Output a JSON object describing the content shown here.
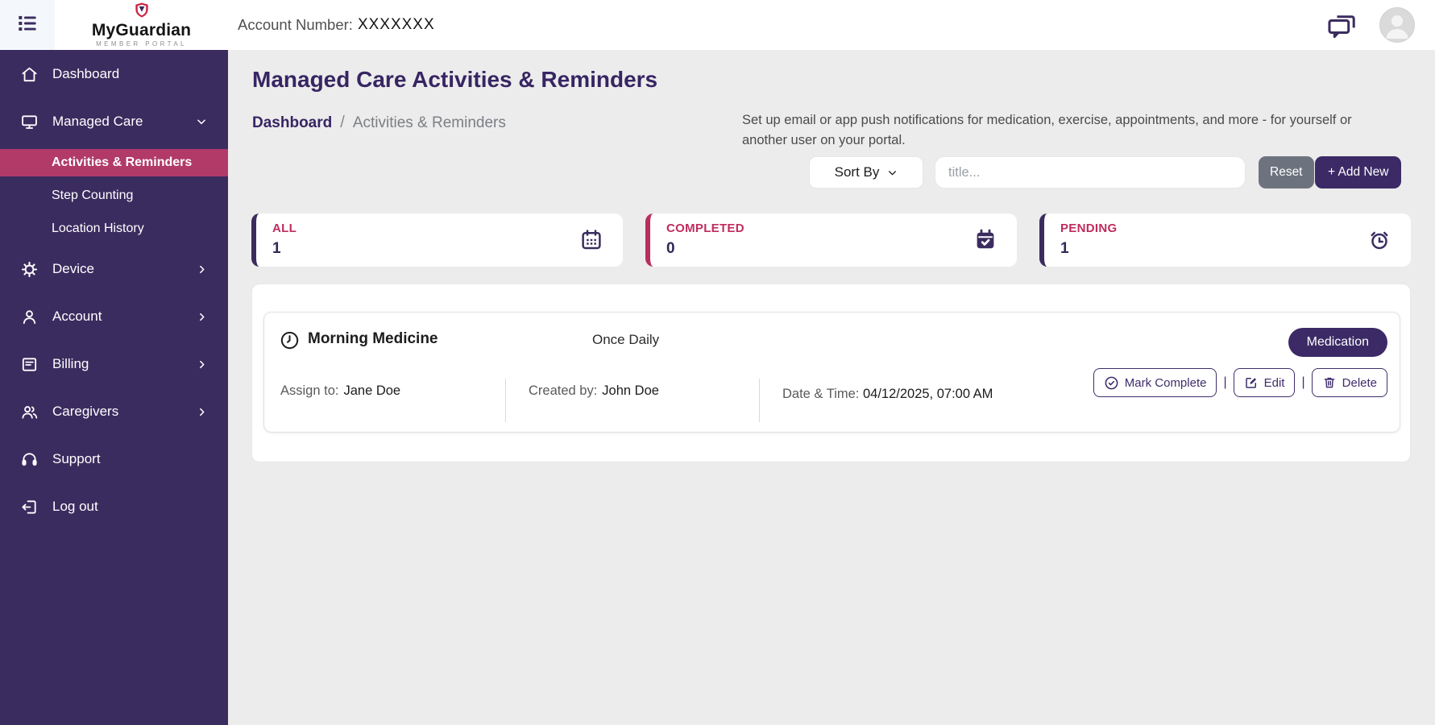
{
  "header": {
    "brand_name": "MyGuardian",
    "brand_tagline": "MEMBER PORTAL",
    "account_label": "Account Number:",
    "account_value": "XXXXXXX"
  },
  "sidebar": {
    "items": [
      {
        "label": "Dashboard"
      },
      {
        "label": "Managed Care"
      },
      {
        "label": "Activities & Reminders"
      },
      {
        "label": "Step Counting"
      },
      {
        "label": "Location History"
      },
      {
        "label": "Device"
      },
      {
        "label": "Account"
      },
      {
        "label": "Billing"
      },
      {
        "label": "Caregivers"
      },
      {
        "label": "Support"
      },
      {
        "label": "Log out"
      }
    ]
  },
  "page": {
    "title": "Managed Care Activities & Reminders",
    "breadcrumb_parent": "Dashboard",
    "breadcrumb_separator": "/",
    "breadcrumb_current": "Activities & Reminders",
    "description": "Set up email or app push notifications for medication, exercise, appointments, and more - for yourself or another user on your portal."
  },
  "toolbar": {
    "sort_label": "Sort By",
    "search_placeholder": "title...",
    "reset_label": "Reset",
    "add_new_label": "+ Add New"
  },
  "stats": [
    {
      "label": "ALL",
      "value": "1",
      "icon": "calendar-icon"
    },
    {
      "label": "COMPLETED",
      "value": "0",
      "icon": "calendar-check-icon"
    },
    {
      "label": "PENDING",
      "value": "1",
      "icon": "alarm-clock-icon"
    }
  ],
  "activity": {
    "title": "Morning Medicine",
    "frequency": "Once Daily",
    "category": "Medication",
    "assign_label": "Assign to:",
    "assign_value": "Jane Doe",
    "created_label": "Created by:",
    "created_value": "John Doe",
    "datetime_label": "Date & Time:",
    "datetime_value": "04/12/2025, 07:00 AM",
    "actions": {
      "mark_complete": "Mark Complete",
      "edit": "Edit",
      "delete": "Delete",
      "separator": "|"
    }
  },
  "colors": {
    "sidebar_purple": "#3b2c5f",
    "accent_purple": "#3b2a66",
    "active_pink": "#b13a69",
    "label_crimson": "#bf2c5e",
    "reset_gray": "#6d737e",
    "main_background": "#ececec"
  }
}
